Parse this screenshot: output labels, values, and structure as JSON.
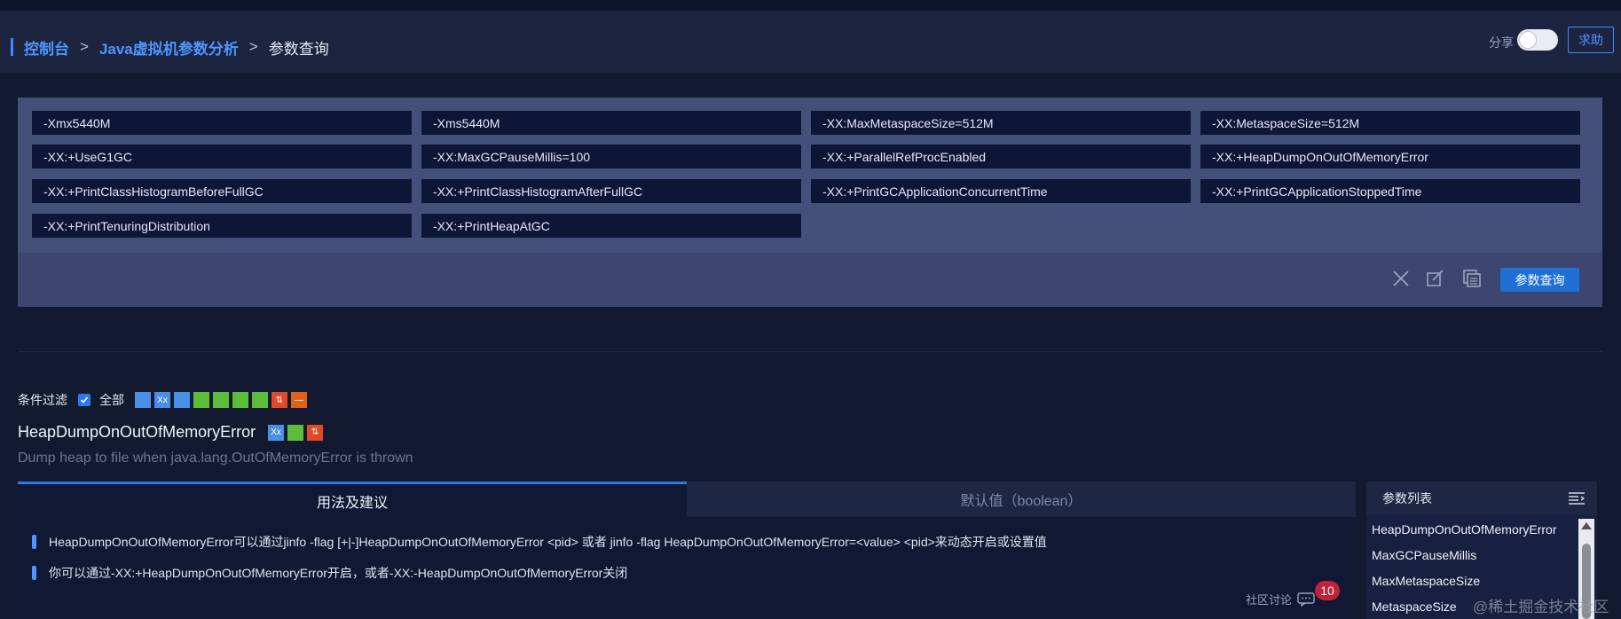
{
  "breadcrumb": {
    "root": "控制台",
    "parent": "Java虚拟机参数分析",
    "current": "参数查询",
    "separator": ">"
  },
  "header": {
    "share_label": "分享",
    "share_enabled": false,
    "help_label": "求助"
  },
  "params": [
    "-Xmx5440M",
    "-Xms5440M",
    "-XX:MaxMetaspaceSize=512M",
    "-XX:MetaspaceSize=512M",
    "-XX:+UseG1GC",
    "-XX:MaxGCPauseMillis=100",
    "-XX:+ParallelRefProcEnabled",
    "-XX:+HeapDumpOnOutOfMemoryError",
    "-XX:+PrintClassHistogramBeforeFullGC",
    "-XX:+PrintClassHistogramAfterFullGC",
    "-XX:+PrintGCApplicationConcurrentTime",
    "-XX:+PrintGCApplicationStoppedTime",
    "-XX:+PrintTenuringDistribution",
    "-XX:+PrintHeapAtGC"
  ],
  "toolbar": {
    "query_label": "参数查询",
    "icons": [
      "close-icon",
      "edit-icon",
      "copy-icon"
    ]
  },
  "filter": {
    "label": "条件过滤",
    "all_label": "全部",
    "all_checked": true,
    "tags": [
      {
        "color": "#4a8fe6",
        "glyph": ""
      },
      {
        "color": "#4a8fe6",
        "glyph": "Xx"
      },
      {
        "color": "#4a8fe6",
        "glyph": ""
      },
      {
        "color": "#5bbd3a",
        "glyph": ""
      },
      {
        "color": "#5bbd3a",
        "glyph": ""
      },
      {
        "color": "#5bbd3a",
        "glyph": ""
      },
      {
        "color": "#5bbd3a",
        "glyph": ""
      },
      {
        "color": "#e04a2a",
        "glyph": "⇅"
      },
      {
        "color": "#e06020",
        "glyph": "—"
      }
    ]
  },
  "selected": {
    "name": "HeapDumpOnOutOfMemoryError",
    "tags": [
      {
        "color": "#4a8fe6",
        "glyph": "Xx"
      },
      {
        "color": "#5bbd3a",
        "glyph": ""
      },
      {
        "color": "#e04a2a",
        "glyph": "⇅"
      }
    ],
    "description": "Dump heap to file when java.lang.OutOfMemoryError is thrown"
  },
  "tabs": [
    {
      "label": "用法及建议",
      "active": true
    },
    {
      "label": "默认值（boolean）",
      "active": false
    }
  ],
  "tips": [
    "HeapDumpOnOutOfMemoryError可以通过jinfo -flag [+|-]HeapDumpOnOutOfMemoryError <pid> 或者 jinfo -flag HeapDumpOnOutOfMemoryError=<value> <pid>来动态开启或设置值",
    "你可以通过-XX:+HeapDumpOnOutOfMemoryError开启，或者-XX:-HeapDumpOnOutOfMemoryError关闭"
  ],
  "param_list": {
    "title": "参数列表",
    "items": [
      "HeapDumpOnOutOfMemoryError",
      "MaxGCPauseMillis",
      "MaxMetaspaceSize",
      "MetaspaceSize"
    ]
  },
  "community": {
    "label": "社区讨论",
    "count": "10"
  },
  "watermark": "@稀土掘金技术社区"
}
